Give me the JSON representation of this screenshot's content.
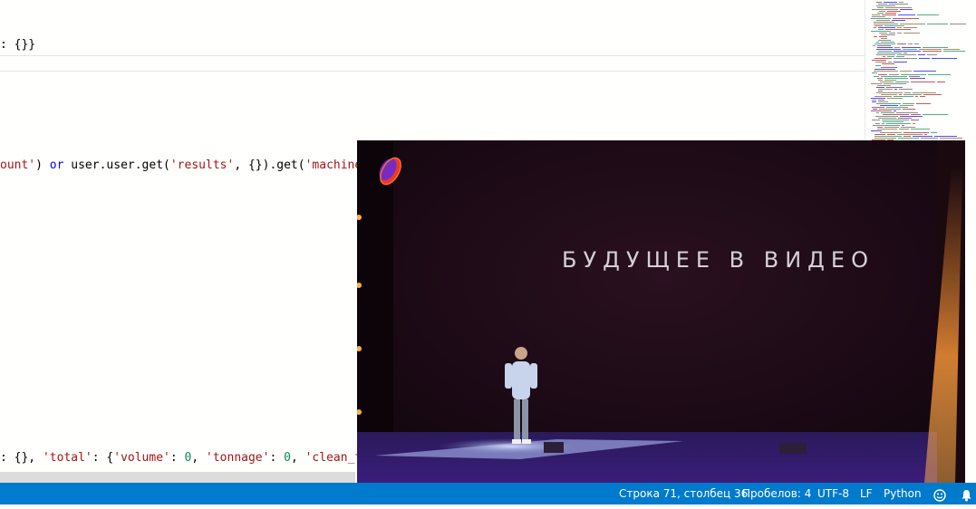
{
  "editor": {
    "lines": [
      {
        "segments": [
          {
            "text": ": {}}",
            "kind": "plain"
          }
        ]
      },
      {
        "segments": [
          {
            "text": "ount'",
            "kind": "str"
          },
          {
            "text": ") ",
            "kind": "plain"
          },
          {
            "text": "or",
            "kind": "kw"
          },
          {
            "text": " user.user.get(",
            "kind": "plain"
          },
          {
            "text": "'results'",
            "kind": "str"
          },
          {
            "text": ", {}).get(",
            "kind": "plain"
          },
          {
            "text": "'machine",
            "kind": "str"
          }
        ]
      },
      {
        "segments": [
          {
            "text": ": {}, ",
            "kind": "plain"
          },
          {
            "text": "'total'",
            "kind": "str"
          },
          {
            "text": ": {",
            "kind": "plain"
          },
          {
            "text": "'volume'",
            "kind": "str"
          },
          {
            "text": ": ",
            "kind": "plain"
          },
          {
            "text": "0",
            "kind": "num"
          },
          {
            "text": ", ",
            "kind": "plain"
          },
          {
            "text": "'tonnage'",
            "kind": "str"
          },
          {
            "text": ": ",
            "kind": "plain"
          },
          {
            "text": "0",
            "kind": "num"
          },
          {
            "text": ", ",
            "kind": "plain"
          },
          {
            "text": "'clean_t",
            "kind": "str"
          }
        ]
      }
    ]
  },
  "video": {
    "headline": "БУДУЩЕЕ В ВИДЕО"
  },
  "statusbar": {
    "position": "Строка 71, столбец 36",
    "indent": "Пробелов: 4",
    "encoding": "UTF-8",
    "eol": "LF",
    "language": "Python",
    "feedback_icon": "smiley-icon",
    "notifications_icon": "bell-icon"
  },
  "colors": {
    "statusbar": "#007acc",
    "string": "#a31515",
    "keyword": "#0000ff",
    "number": "#098658"
  }
}
